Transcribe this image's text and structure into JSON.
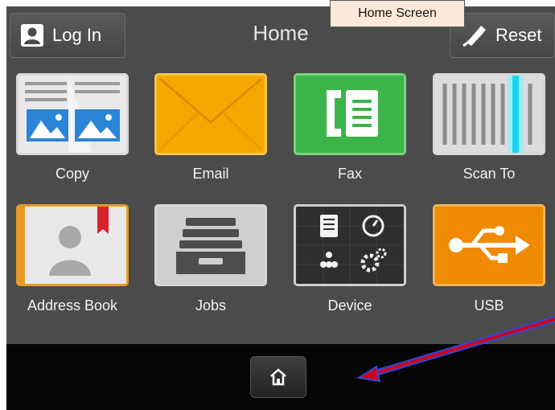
{
  "header": {
    "login_label": "Log In",
    "title": "Home",
    "reset_label": "Reset"
  },
  "annotation": {
    "label": "Home Screen"
  },
  "apps": [
    {
      "label": "Copy",
      "icon": "copy-icon"
    },
    {
      "label": "Email",
      "icon": "envelope-icon"
    },
    {
      "label": "Fax",
      "icon": "fax-icon"
    },
    {
      "label": "Scan To",
      "icon": "scanner-icon"
    },
    {
      "label": "Address Book",
      "icon": "address-book-icon"
    },
    {
      "label": "Jobs",
      "icon": "jobs-icon"
    },
    {
      "label": "Device",
      "icon": "device-icon"
    },
    {
      "label": "USB",
      "icon": "usb-icon"
    }
  ],
  "dock": {
    "home_icon": "home-icon"
  },
  "colors": {
    "screen_bg": "#4b4b4b",
    "email": "#f5a800",
    "fax": "#3bb54a",
    "usb": "#f08a00",
    "annotation_bg": "#fde9d9",
    "arrow": "#d0021b",
    "arrow_outline": "#2a4bd7"
  }
}
